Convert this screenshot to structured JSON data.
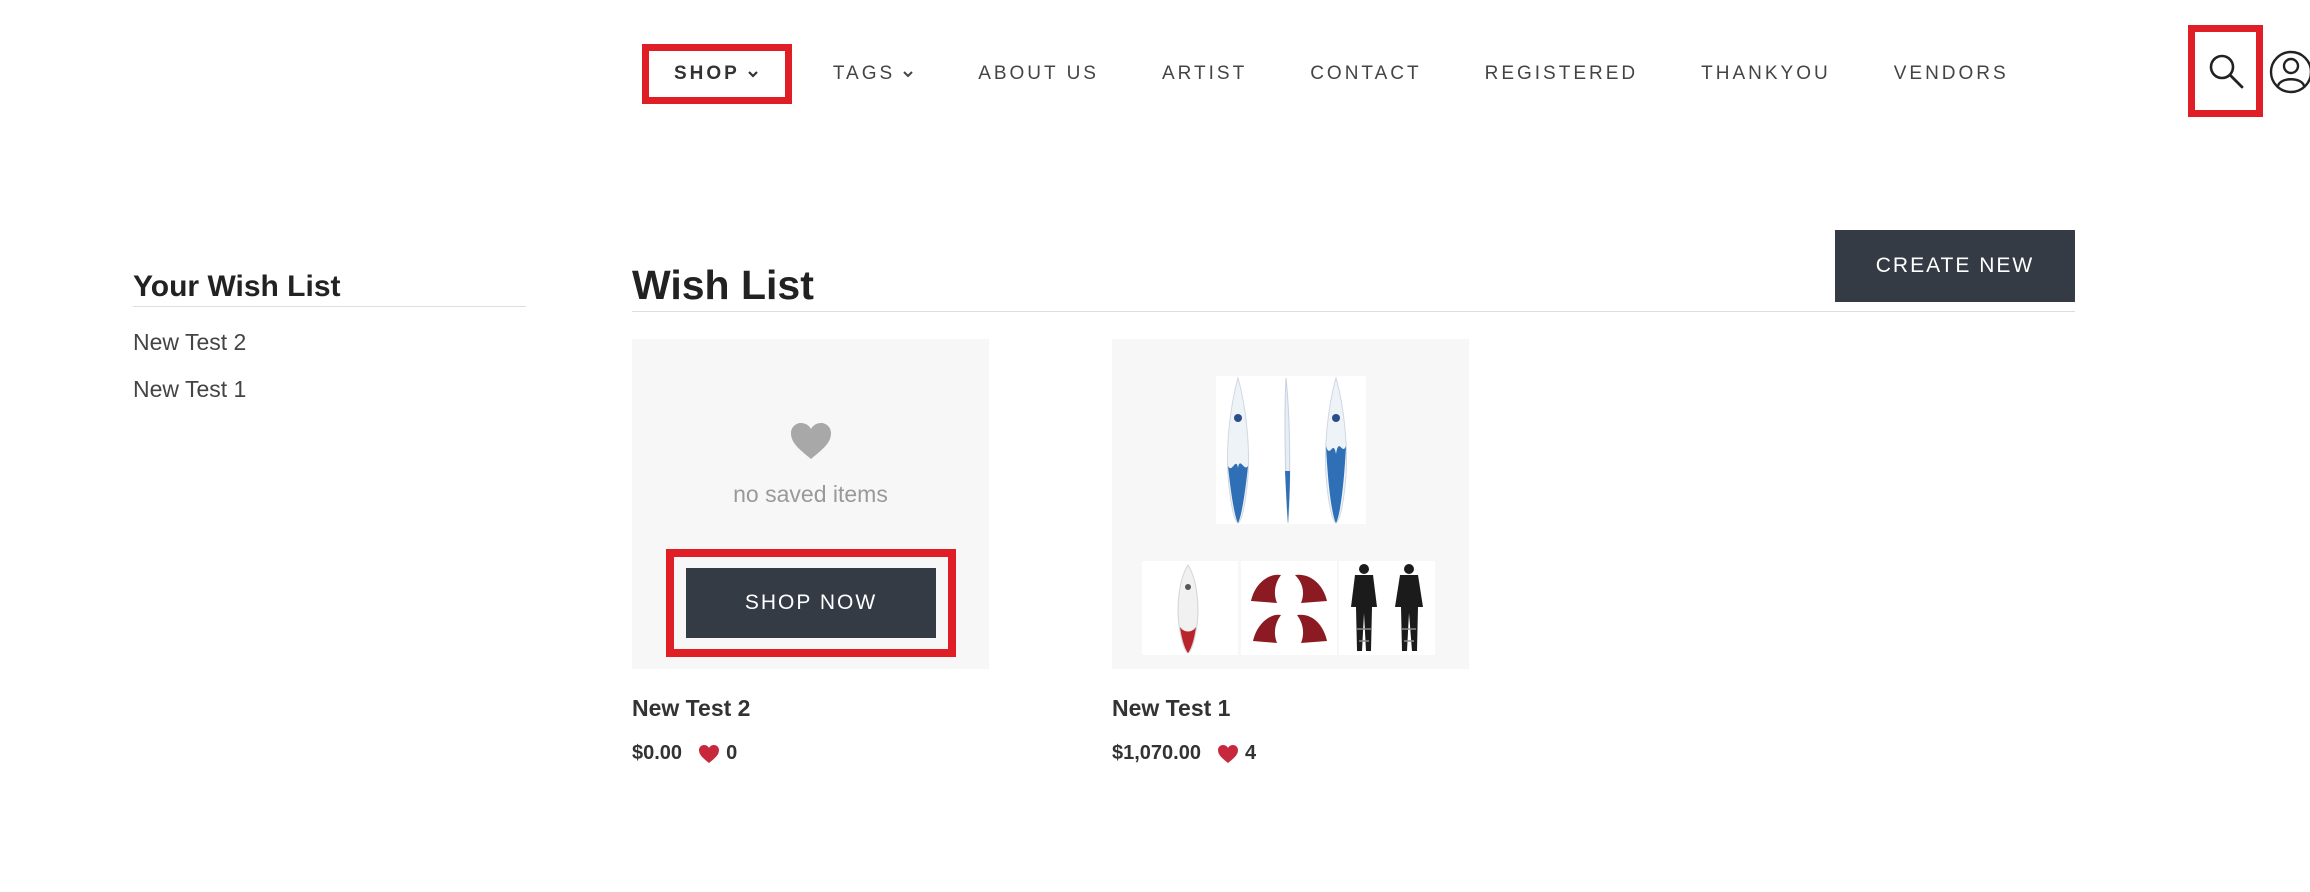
{
  "nav": {
    "items": [
      {
        "label": "SHOP",
        "dropdown": true,
        "highlighted": true
      },
      {
        "label": "TAGS",
        "dropdown": true,
        "highlighted": false
      },
      {
        "label": "ABOUT US",
        "dropdown": false,
        "highlighted": false
      },
      {
        "label": "ARTIST",
        "dropdown": false,
        "highlighted": false
      },
      {
        "label": "CONTACT",
        "dropdown": false,
        "highlighted": false
      },
      {
        "label": "REGISTERED",
        "dropdown": false,
        "highlighted": false
      },
      {
        "label": "THANKYOU",
        "dropdown": false,
        "highlighted": false
      },
      {
        "label": "VENDORS",
        "dropdown": false,
        "highlighted": false
      }
    ],
    "search_icon": "search-icon",
    "account_icon": "user-account-icon"
  },
  "sidebar": {
    "title": "Your Wish List",
    "items": [
      {
        "label": "New Test 2"
      },
      {
        "label": "New Test 1"
      }
    ]
  },
  "main": {
    "title": "Wish List",
    "create_label": "CREATE NEW",
    "cards": [
      {
        "name": "New Test 2",
        "price": "$0.00",
        "likes": "0",
        "empty_text": "no saved items",
        "button_label": "SHOP NOW"
      },
      {
        "name": "New Test 1",
        "price": "$1,070.00",
        "likes": "4"
      }
    ]
  },
  "colors": {
    "accent_red": "#e01e26",
    "button_dark": "#353b44",
    "heart_red": "#c8283c",
    "heart_grey": "#a8a8a8"
  }
}
